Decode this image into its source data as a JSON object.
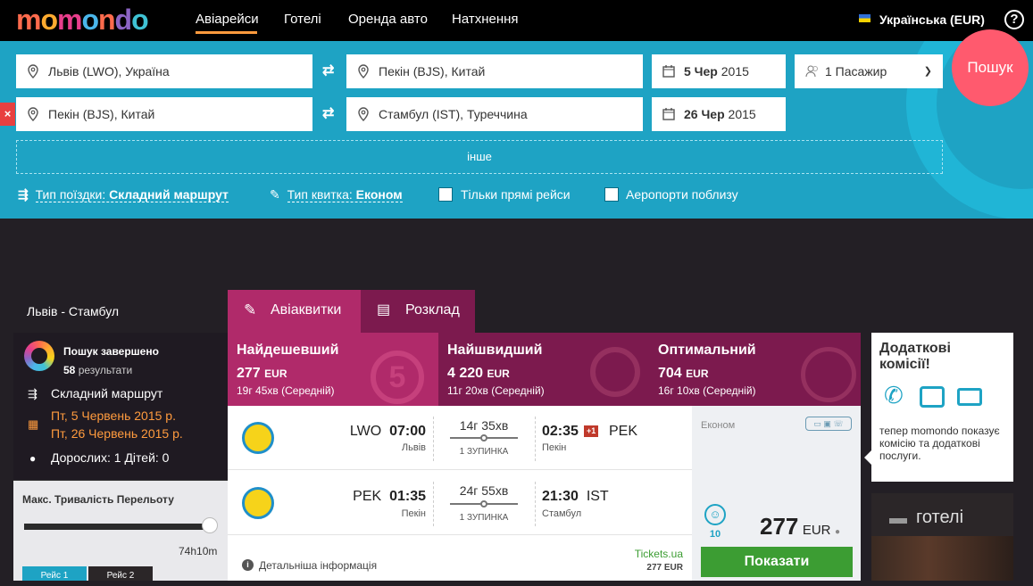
{
  "header": {
    "logo": [
      "m",
      "o",
      "m",
      "o",
      "n",
      "d",
      "o"
    ],
    "logo_colors": [
      "#ff6b4d",
      "#ffab2f",
      "#e83e8c",
      "#4ab6ea",
      "#ff6b4d",
      "#8c64c4",
      "#3fc2d4"
    ],
    "nav": [
      "Авіарейси",
      "Готелі",
      "Оренда авто",
      "Натхнення"
    ],
    "language": "Українська (EUR)",
    "help": "?"
  },
  "search": {
    "leg1": {
      "from": "Львів (LWO), Україна",
      "to": "Пекін (BJS), Китай",
      "date_bold": "5 Чер",
      "date_year": " 2015"
    },
    "leg2": {
      "from": "Пекін (BJS), Китай",
      "to": "Стамбул (IST), Туреччина",
      "date_bold": "26 Чер",
      "date_year": " 2015"
    },
    "passengers": "1 Пасажир",
    "search_button": "Пошук",
    "remove_leg": "×",
    "other": "інше",
    "trip_type_label": "Тип поїздки:",
    "trip_type_value": "Складний маршрут",
    "ticket_type_label": "Тип квитка:",
    "ticket_type_value": "Економ",
    "direct_only": "Тільки прямі рейси",
    "nearby_airports": "Аеропорти поблизу"
  },
  "sidebar": {
    "route": "Львів - Стамбул",
    "status": "Пошук завершено",
    "results_count": "58",
    "results_label": " результати",
    "trip_type": "Складний маршрут",
    "date1": "Пт, 5 Червень 2015 р.",
    "date2": "Пт, 26 Червень 2015 р.",
    "travellers": "Дорослих: 1 Дітей: 0",
    "filter_title": "Макс. Тривалість Перельоту",
    "filter_value": "74h10m",
    "filter_slider_fraction": 1.0,
    "flight1": "Рейс 1",
    "flight2": "Рейс 2"
  },
  "tabs": {
    "tickets": "Авіаквитки",
    "schedule": "Розклад"
  },
  "sort": [
    {
      "title": "Найдешевший",
      "price": "277",
      "currency": "EUR",
      "detail": "19г 45хв (Середній)",
      "color": "#b02a6a"
    },
    {
      "title": "Найшвидший",
      "price": "4 220",
      "currency": "EUR",
      "detail": "11г 20хв (Середній)",
      "color": "#7c1a4e"
    },
    {
      "title": "Оптимальний",
      "price": "704",
      "currency": "EUR",
      "detail": "16г 10хв (Середній)",
      "color": "#7c1a4e"
    }
  ],
  "result": {
    "segments": [
      {
        "dep_code": "LWO",
        "dep_time": "07:00",
        "dep_city": "Львів",
        "duration": "14г 35хв",
        "stops": "1 ЗУПИНКА",
        "arr_time": "02:35",
        "day_offset": "+1",
        "arr_code": "PEK",
        "arr_city": "Пекін"
      },
      {
        "dep_code": "PEK",
        "dep_time": "01:35",
        "dep_city": "Пекін",
        "duration": "24г 55хв",
        "stops": "1 ЗУПИНКА",
        "arr_time": "21:30",
        "arr_code": "IST",
        "arr_city": "Стамбул"
      }
    ],
    "details": "Детальніша інформація",
    "provider": "Tickets.ua",
    "provider_price": "277 EUR",
    "cabin": "Економ",
    "rating": "10",
    "price": "277",
    "currency": "EUR",
    "show_button": "Показати"
  },
  "fees": {
    "title": "Додаткові комісії!",
    "text": "тепер momondo показує комісію та додаткові послуги."
  },
  "hotels": {
    "title": "готелі"
  }
}
